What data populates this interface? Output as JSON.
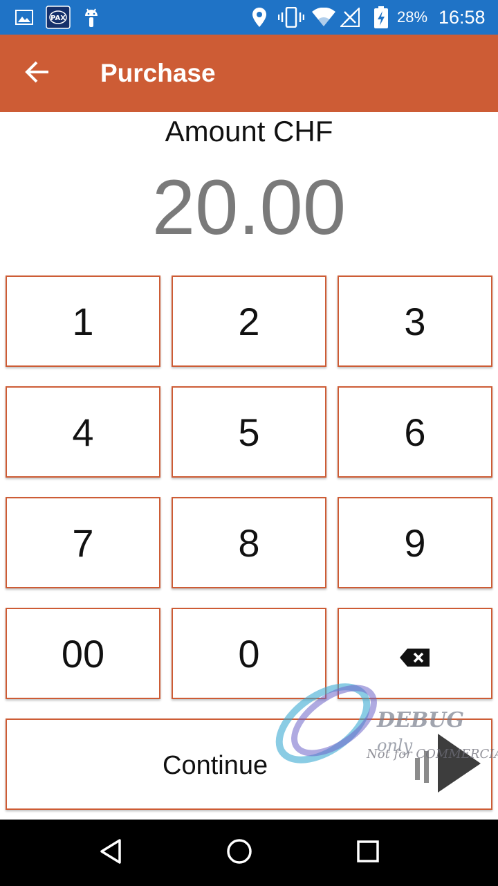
{
  "status_bar": {
    "icons": [
      "image-icon",
      "pax-icon",
      "android-icon",
      "location-icon",
      "vibrate-icon",
      "wifi-icon",
      "signal-icon",
      "battery-charging-icon"
    ],
    "battery_percent": "28%",
    "time": "16:58"
  },
  "app_bar": {
    "title": "Purchase",
    "back_icon": "arrow-left-icon",
    "color": "#cd5c35"
  },
  "amount": {
    "label": "Amount CHF",
    "value": "20.00"
  },
  "keypad": {
    "keys": [
      "1",
      "2",
      "3",
      "4",
      "5",
      "6",
      "7",
      "8",
      "9",
      "00",
      "0"
    ],
    "backspace_icon": "backspace-icon"
  },
  "continue_label": "Continue",
  "watermark": {
    "line1_main": "DEBUG",
    "line1_small": " only",
    "line2": "Not for COMMERCIAL"
  },
  "nav_bar": {
    "icons": [
      "nav-back-icon",
      "nav-home-icon",
      "nav-recents-icon"
    ]
  },
  "colors": {
    "status_bar": "#1f73c6",
    "accent": "#cd5c35",
    "amount_text": "#7a7a7a"
  }
}
